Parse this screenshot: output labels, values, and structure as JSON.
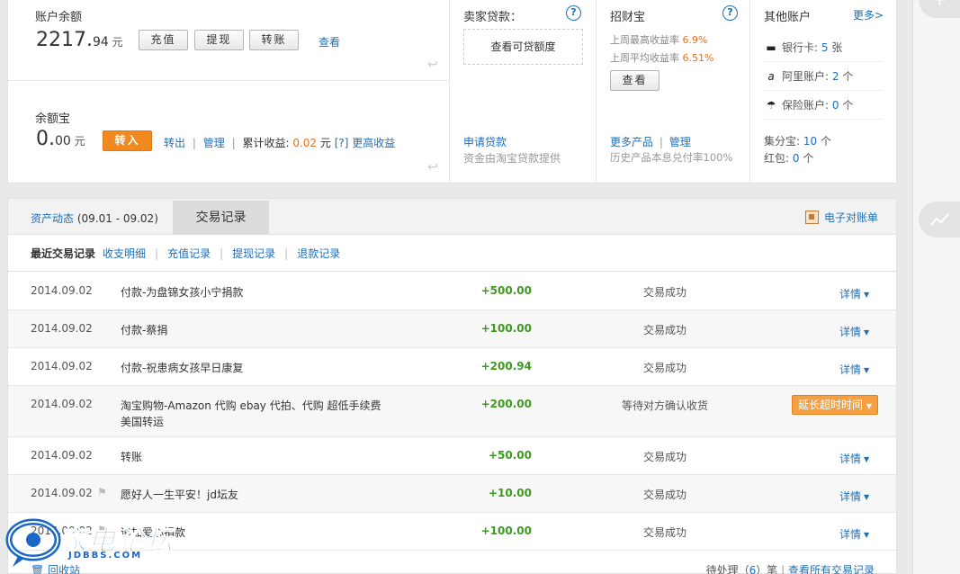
{
  "account": {
    "balance_title": "账户余额",
    "balance_int": "2217.",
    "balance_dec": "94",
    "balance_unit": "元",
    "btn_recharge": "充值",
    "btn_withdraw": "提现",
    "btn_transfer": "转账",
    "view_link": "查看",
    "yeb_title": "余额宝",
    "yeb_int": "0.",
    "yeb_dec": "00",
    "yeb_unit": "元",
    "btn_transfer_in": "转入",
    "transfer_out": "转出",
    "manage": "管理",
    "cumulative_label": "累计收益:",
    "cumulative_value": "0.02",
    "cumulative_unit": "元",
    "help_mark": "[?]",
    "more_income": "更高收益"
  },
  "loan": {
    "title": "卖家贷款：",
    "check_quota": "查看可贷额度",
    "apply": "申请贷款",
    "provider": "资金由淘宝贷款提供"
  },
  "zhaocaibao": {
    "title": "招财宝",
    "max_rate_label": "上周最高收益率",
    "max_rate": "6.9%",
    "avg_rate_label": "上周平均收益率",
    "avg_rate": "6.51%",
    "view_btn": "查看",
    "more_products": "更多产品",
    "manage": "管理",
    "history": "历史产品本息兑付率100%"
  },
  "other_accounts": {
    "title": "其他账户",
    "more": "更多>",
    "bank_card_label": "银行卡:",
    "bank_card_value": "5",
    "bank_card_unit": "张",
    "ali_label": "阿里账户:",
    "ali_value": "2",
    "ali_unit": "个",
    "insurance_label": "保险账户:",
    "insurance_value": "0",
    "insurance_unit": "个",
    "jifenbao_label": "集分宝:",
    "jifenbao_value": "10",
    "jifenbao_unit": "个",
    "hongbao_label": "红包:",
    "hongbao_value": "0",
    "hongbao_unit": "个"
  },
  "tabs": {
    "asset": "资产动态",
    "asset_range": "(09.01 - 09.02)",
    "transactions": "交易记录",
    "ebill": "电子对账单"
  },
  "subnav": {
    "recent": "最近交易记录",
    "income_expense": "收支明细",
    "recharge": "充值记录",
    "withdraw": "提现记录",
    "refund": "退款记录"
  },
  "rows": [
    {
      "date": "2014.09.02",
      "desc": "付款-为盘锦女孩小宁捐款",
      "amount": "+500.00",
      "status": "交易成功",
      "detail": "详情"
    },
    {
      "date": "2014.09.02",
      "desc": "付款-蔡捐",
      "amount": "+100.00",
      "status": "交易成功",
      "detail": "详情"
    },
    {
      "date": "2014.09.02",
      "desc": "付款-祝患病女孩早日康复",
      "amount": "+200.94",
      "status": "交易成功",
      "detail": "详情"
    },
    {
      "date": "2014.09.02",
      "desc": "淘宝购物-Amazon 代购 ebay 代拍、代购 超低手续费 美国转运",
      "amount": "+200.00",
      "status": "等待对方确认收货",
      "action": "延长超时时间"
    },
    {
      "date": "2014.09.02",
      "desc": "转账",
      "amount": "+50.00",
      "status": "交易成功",
      "detail": "详情"
    },
    {
      "date": "2014.09.02",
      "desc": "愿好人一生平安！jd坛友",
      "amount": "+10.00",
      "status": "交易成功",
      "detail": "详情"
    },
    {
      "date": "2014.09.02",
      "desc": "追加爱心捐款",
      "amount": "+100.00",
      "status": "交易成功",
      "detail": "详情"
    }
  ],
  "footer": {
    "recycle": "回收站",
    "pending_prefix": "待处理（",
    "pending_count": "6",
    "pending_suffix": "）笔",
    "view_all": "查看所有交易记录"
  },
  "watermark": {
    "brand": "家电论坛",
    "site": "JDBBS.COM"
  },
  "colors": {
    "link": "#1e6fb8",
    "orange": "#e8701a",
    "amount_green": "#3d9a1f",
    "button_orange": "#f08a1e"
  }
}
